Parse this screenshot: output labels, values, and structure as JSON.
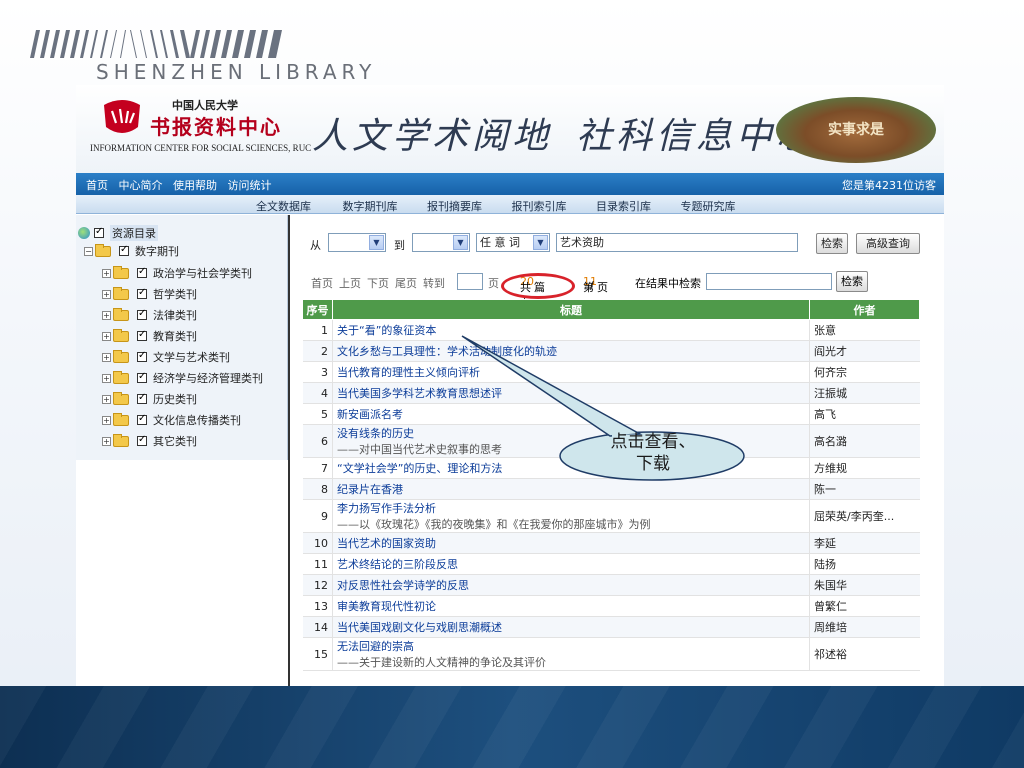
{
  "slide": {
    "library_title": "SHENZHEN LIBRARY"
  },
  "banner": {
    "logo_top": "中国人民大学",
    "logo_main": "书报资料中心",
    "logo_en": "INFORMATION CENTER FOR SOCIAL SCIENCES, RUC",
    "calligraphy_1": "人文学术阅地",
    "calligraphy_2": "社科信息中心",
    "rock_text": "实事求是"
  },
  "topnav": {
    "links": [
      "首页",
      "中心简介",
      "使用帮助",
      "访问统计"
    ],
    "visits": "您是第4231位访客"
  },
  "subnav": {
    "items": [
      "全文数据库",
      "数字期刊库",
      "报刊摘要库",
      "报刊索引库",
      "目录索引库",
      "专题研究库"
    ]
  },
  "tree": {
    "root": "资源目录",
    "child": "数字期刊",
    "categories": [
      "政治学与社会学类刊",
      "哲学类刊",
      "法律类刊",
      "教育类刊",
      "文学与艺术类刊",
      "经济学与经济管理类刊",
      "历史类刊",
      "文化信息传播类刊",
      "其它类刊"
    ]
  },
  "search": {
    "from_label": "从",
    "to_label": "到",
    "field_value": "任 意 词",
    "query": "艺术资助",
    "search_btn": "检索",
    "advanced_btn": "高级查询"
  },
  "pager": {
    "first": "首页",
    "prev": "上页",
    "next": "下页",
    "last": "尾页",
    "goto": "转到",
    "page_unit": "页",
    "count_prefix": "共有",
    "count_value": "20",
    "count_suffix": "篇",
    "page_prefix": "第",
    "page_current": "1",
    "page_sep": "/",
    "page_total": "1",
    "page_suffix": "页",
    "within_label": "在结果中检索",
    "within_btn": "检索"
  },
  "table": {
    "headers": [
      "序号",
      "标题",
      "作者"
    ],
    "rows": [
      {
        "no": "1",
        "title": "关于“看”的象征资本",
        "sub": "",
        "author": "张意"
      },
      {
        "no": "2",
        "title": "文化乡愁与工具理性：学术活动制度化的轨迹",
        "sub": "",
        "author": "阎光才"
      },
      {
        "no": "3",
        "title": "当代教育的理性主义倾向评析",
        "sub": "",
        "author": "何齐宗"
      },
      {
        "no": "4",
        "title": "当代美国多学科艺术教育思想述评",
        "sub": "",
        "author": "汪振城"
      },
      {
        "no": "5",
        "title": "新安画派名考",
        "sub": "",
        "author": "高飞"
      },
      {
        "no": "6",
        "title": "没有线条的历史",
        "sub": "——对中国当代艺术史叙事的思考",
        "author": "高名潞"
      },
      {
        "no": "7",
        "title": "“文学社会学”的历史、理论和方法",
        "sub": "",
        "author": "方维规"
      },
      {
        "no": "8",
        "title": "纪录片在香港",
        "sub": "",
        "author": "陈一"
      },
      {
        "no": "9",
        "title": "李力扬写作手法分析",
        "sub": "——以《玫瑰花》《我的夜晚集》和《在我爱你的那座城市》为例",
        "author": "屈荣英/李丙奎..."
      },
      {
        "no": "10",
        "title": "当代艺术的国家资助",
        "sub": "",
        "author": "李延"
      },
      {
        "no": "11",
        "title": "艺术终结论的三阶段反思",
        "sub": "",
        "author": "陆扬"
      },
      {
        "no": "12",
        "title": "对反思性社会学诗学的反思",
        "sub": "",
        "author": "朱国华"
      },
      {
        "no": "13",
        "title": "审美教育现代性初论",
        "sub": "",
        "author": "曾繁仁"
      },
      {
        "no": "14",
        "title": "当代美国戏剧文化与戏剧思潮概述",
        "sub": "",
        "author": "周维培"
      },
      {
        "no": "15",
        "title": "无法回避的崇高",
        "sub": "——关于建设新的人文精神的争论及其评价",
        "author": "祁述裕"
      }
    ]
  },
  "callout": {
    "line1": "点击查看、",
    "line2": "下载"
  },
  "colors": {
    "nav_blue": "#1661a8",
    "table_header_green": "#4f9a4a",
    "highlight_red": "#d8222a",
    "count_orange": "#e07b00",
    "link_blue": "#0c3d99"
  }
}
